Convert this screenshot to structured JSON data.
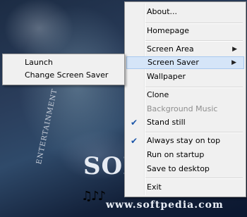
{
  "background": {
    "logo_text": "SOF",
    "url_text": "www.softpedia.com",
    "side_text": "ENTERTAINMENT",
    "notes_glyphs": "♫♪♪"
  },
  "main_menu": {
    "items": [
      {
        "label": "About...",
        "checked": false,
        "submenu": false,
        "disabled": false
      },
      {
        "label": "Homepage",
        "checked": false,
        "submenu": false,
        "disabled": false
      },
      {
        "label": "Screen Area",
        "checked": false,
        "submenu": true,
        "disabled": false
      },
      {
        "label": "Screen Saver",
        "checked": false,
        "submenu": true,
        "disabled": false,
        "highlighted": true
      },
      {
        "label": "Wallpaper",
        "checked": false,
        "submenu": false,
        "disabled": false
      },
      {
        "label": "Clone",
        "checked": false,
        "submenu": false,
        "disabled": false
      },
      {
        "label": "Background Music",
        "checked": false,
        "submenu": false,
        "disabled": true
      },
      {
        "label": "Stand still",
        "checked": true,
        "submenu": false,
        "disabled": false
      },
      {
        "label": "Always stay on top",
        "checked": true,
        "submenu": false,
        "disabled": false
      },
      {
        "label": "Run on startup",
        "checked": false,
        "submenu": false,
        "disabled": false
      },
      {
        "label": "Save to desktop",
        "checked": false,
        "submenu": false,
        "disabled": false
      },
      {
        "label": "Exit",
        "checked": false,
        "submenu": false,
        "disabled": false
      }
    ],
    "check_glyph": "✔",
    "arrow_glyph": "▶"
  },
  "sub_menu": {
    "items": [
      {
        "label": "Launch"
      },
      {
        "label": "Change Screen Saver"
      }
    ]
  }
}
